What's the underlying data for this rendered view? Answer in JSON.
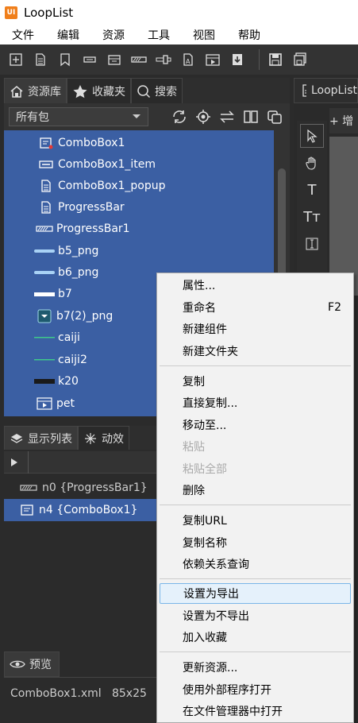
{
  "app": {
    "title": "LoopList",
    "icon_text": "UI"
  },
  "menu": [
    "文件",
    "编辑",
    "资源",
    "工具",
    "视图",
    "帮助"
  ],
  "toolbar_icons": [
    "new-component-icon",
    "new-doc-icon",
    "bookmark-icon",
    "panel-icon",
    "box-icon",
    "progressbar-icon",
    "slider-icon",
    "text-icon",
    "movie-icon",
    "import-icon",
    "save-icon",
    "save-all-icon"
  ],
  "library": {
    "tabs": [
      {
        "label": "资源库",
        "icon": "home-icon"
      },
      {
        "label": "收藏夹",
        "icon": "star-icon"
      },
      {
        "label": "搜索",
        "icon": "search-icon"
      }
    ],
    "package_select": "所有包",
    "tools": [
      "refresh-icon",
      "locate-icon",
      "swap-icon",
      "columns-icon",
      "copy-icon"
    ],
    "items": [
      {
        "label": "ComboBox1",
        "icon": "combobox-icon"
      },
      {
        "label": "ComboBox1_item",
        "icon": "button-icon"
      },
      {
        "label": "ComboBox1_popup",
        "icon": "doc-icon"
      },
      {
        "label": "ProgressBar",
        "icon": "doc-icon"
      },
      {
        "label": "ProgressBar1",
        "icon": "progressbar-icon"
      },
      {
        "label": "b5_png",
        "icon": "image-bar-icon"
      },
      {
        "label": "b6_png",
        "icon": "image-bar-icon"
      },
      {
        "label": "b7",
        "icon": "white-bar-icon"
      },
      {
        "label": "b7(2)_png",
        "icon": "dropdown-image-icon"
      },
      {
        "label": "caiji",
        "icon": "green-line-icon"
      },
      {
        "label": "caiji2",
        "icon": "green-line-icon"
      },
      {
        "label": "k20",
        "icon": "black-bar-icon"
      },
      {
        "label": "pet",
        "icon": "movie-icon"
      }
    ]
  },
  "right_panel": {
    "tab_label": "LoopList",
    "add_label": "+ 增"
  },
  "display_list": {
    "tabs": [
      {
        "label": "显示列表",
        "icon": "layers-icon"
      },
      {
        "label": "动效",
        "icon": "sparkle-icon"
      }
    ],
    "items": [
      {
        "label": "n0 {ProgressBar1}",
        "icon": "progressbar-icon",
        "selected": false
      },
      {
        "label": "n4 {ComboBox1}",
        "icon": "combobox-icon",
        "selected": true
      }
    ]
  },
  "preview": {
    "tab_label": "预览",
    "info": "ComboBox1.xml   85x25"
  },
  "context_menu": [
    {
      "label": "属性...",
      "shortcut": ""
    },
    {
      "label": "重命名",
      "shortcut": "F2"
    },
    {
      "label": "新建组件",
      "shortcut": ""
    },
    {
      "label": "新建文件夹",
      "shortcut": ""
    },
    {
      "label": "复制",
      "shortcut": ""
    },
    {
      "label": "直接复制...",
      "shortcut": ""
    },
    {
      "label": "移动至...",
      "shortcut": ""
    },
    {
      "label": "粘贴",
      "shortcut": "",
      "disabled": true
    },
    {
      "label": "粘贴全部",
      "shortcut": "",
      "disabled": true
    },
    {
      "label": "删除",
      "shortcut": ""
    },
    {
      "label": "复制URL",
      "shortcut": ""
    },
    {
      "label": "复制名称",
      "shortcut": ""
    },
    {
      "label": "依赖关系查询",
      "shortcut": ""
    },
    {
      "label": "设置为导出",
      "shortcut": "",
      "hover": true
    },
    {
      "label": "设置为不导出",
      "shortcut": ""
    },
    {
      "label": "加入收藏",
      "shortcut": ""
    },
    {
      "label": "更新资源...",
      "shortcut": ""
    },
    {
      "label": "使用外部程序打开",
      "shortcut": ""
    },
    {
      "label": "在文件管理器中打开",
      "shortcut": ""
    }
  ],
  "colors": {
    "selection": "#3b5fa3",
    "accent_orange": "#f07f1b",
    "menu_hover": "#e5f1fb"
  }
}
